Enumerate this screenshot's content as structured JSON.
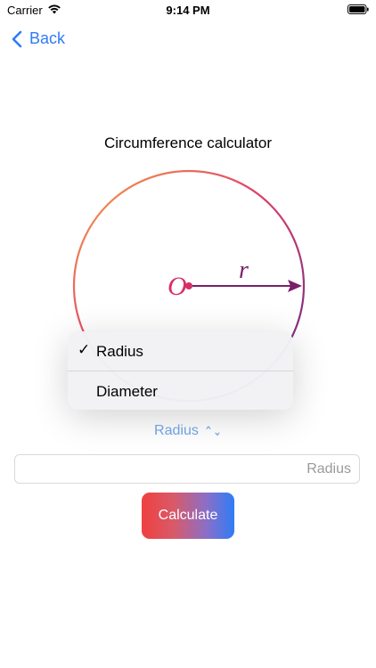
{
  "status_bar": {
    "carrier": "Carrier",
    "time": "9:14 PM"
  },
  "nav": {
    "back_label": "Back"
  },
  "title": "Circumference calculator",
  "diagram": {
    "center_label": "O",
    "radius_label": "r"
  },
  "menu": {
    "items": [
      {
        "label": "Radius",
        "checked": true
      },
      {
        "label": "Diameter",
        "checked": false
      }
    ],
    "check_mark": "✓"
  },
  "picker": {
    "selected": "Radius"
  },
  "input": {
    "placeholder": "Radius",
    "value": ""
  },
  "calculate_label": "Calculate",
  "colors": {
    "accent": "#2f7cf6",
    "gradient_start": "#f04040",
    "gradient_end": "#2f7cf6",
    "circle_orange": "#f39a4a",
    "circle_purple": "#6a2a8a"
  }
}
